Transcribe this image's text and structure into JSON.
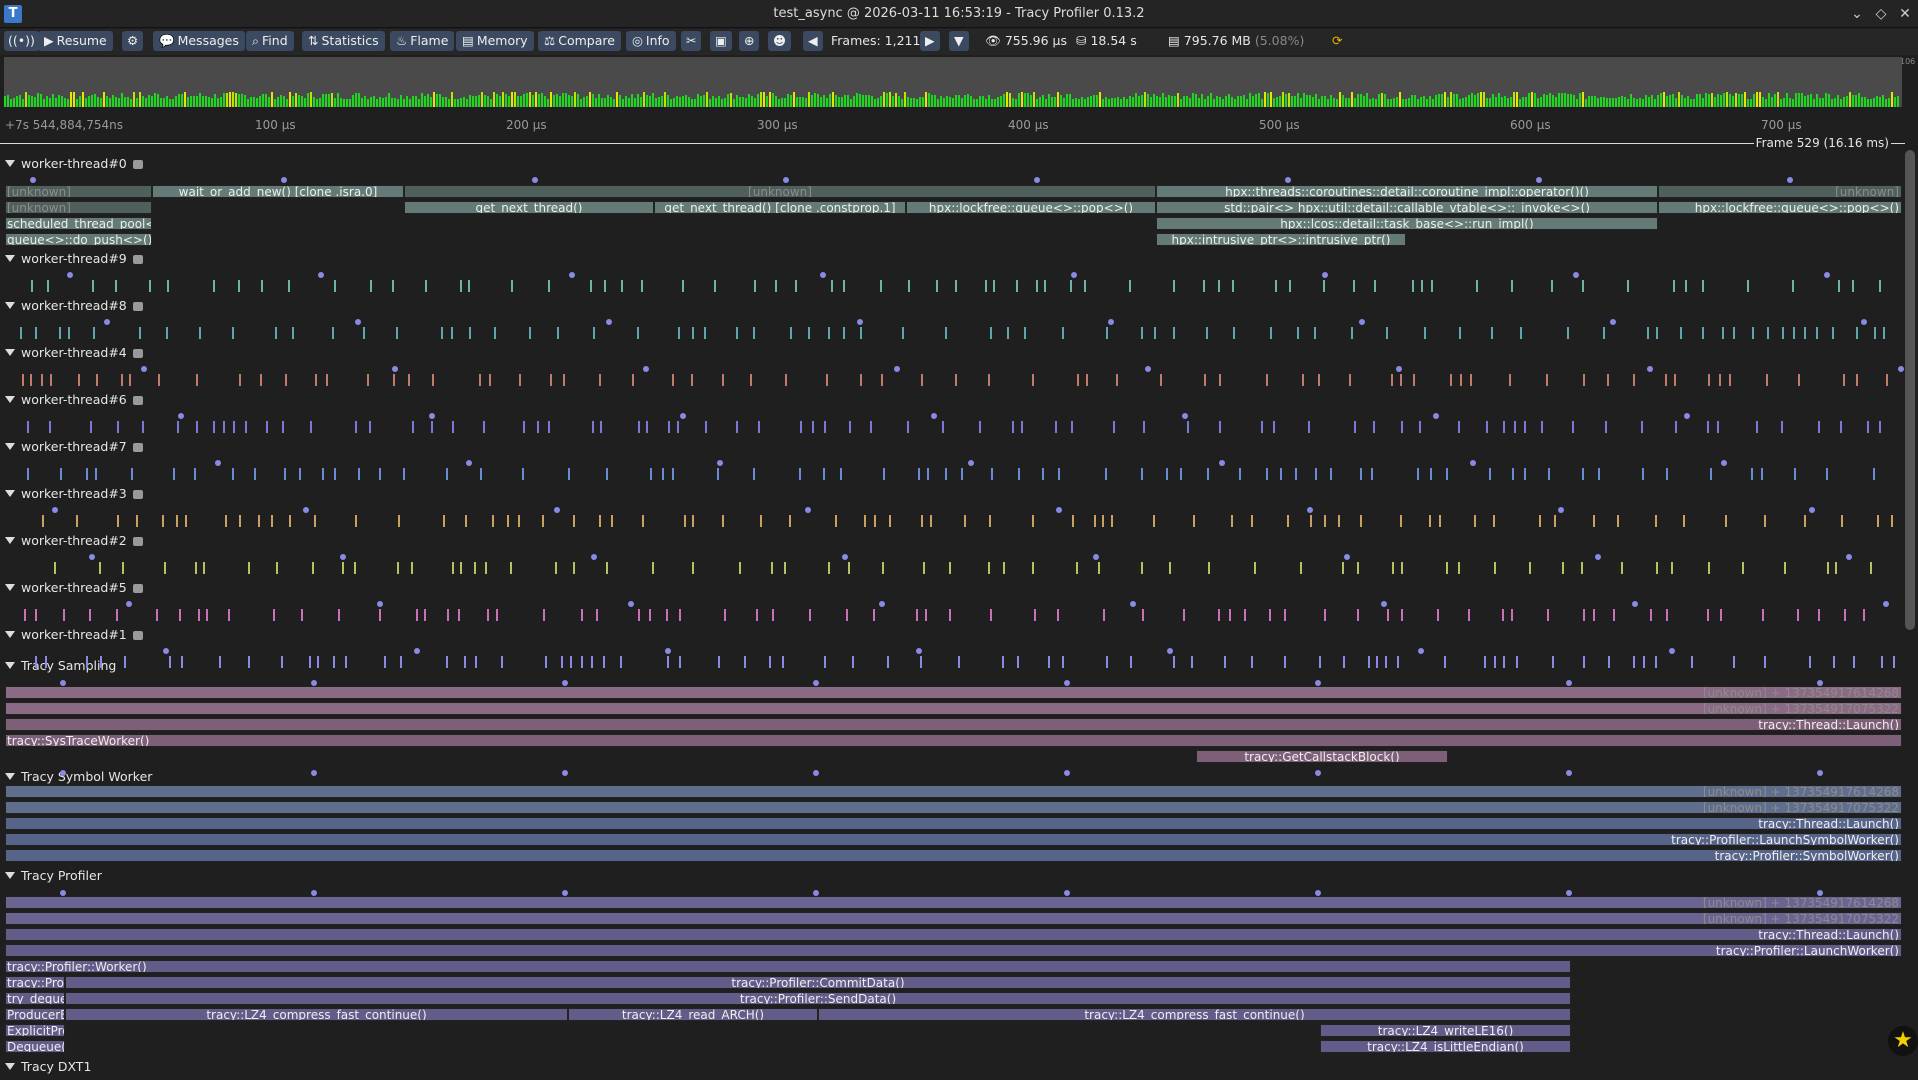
{
  "window": {
    "title": "test_async @ 2026-03-11 16:53:19 - Tracy Profiler 0.13.2",
    "logo": "T"
  },
  "toolbar": {
    "buttons": [
      {
        "name": "resume-button",
        "label": "Resume",
        "icon": "play-icon"
      },
      {
        "name": "settings-button",
        "label": "",
        "icon": "gear-icon"
      },
      {
        "name": "messages-button",
        "label": "Messages",
        "icon": "speech-bubble-icon"
      },
      {
        "name": "find-button",
        "label": "Find",
        "icon": "magnifier-icon"
      },
      {
        "name": "statistics-button",
        "label": "Statistics",
        "icon": "sort-icon"
      },
      {
        "name": "flame-button",
        "label": "Flame",
        "icon": "flame-icon"
      },
      {
        "name": "memory-button",
        "label": "Memory",
        "icon": "memory-icon"
      },
      {
        "name": "compare-button",
        "label": "Compare",
        "icon": "scale-icon"
      },
      {
        "name": "info-button",
        "label": "Info",
        "icon": "fingerprint-icon"
      }
    ],
    "frames_label": "Frames: 1,211",
    "view_time": "755.96 µs",
    "total_time": "18.54 s",
    "memory_used": "795.76 MB",
    "memory_percent": "(5.08%)",
    "top_tick": "106"
  },
  "ruler": {
    "labels": [
      "+7s 544,884,754ns",
      "100 µs",
      "200 µs",
      "300 µs",
      "400 µs",
      "500 µs",
      "600 µs",
      "700 µs"
    ],
    "frame_label": "Frame 529 (16.16 ms)"
  },
  "threads": [
    {
      "label": "worker-thread#0"
    },
    {
      "label": "worker-thread#9"
    },
    {
      "label": "worker-thread#8"
    },
    {
      "label": "worker-thread#4"
    },
    {
      "label": "worker-thread#6"
    },
    {
      "label": "worker-thread#7"
    },
    {
      "label": "worker-thread#3"
    },
    {
      "label": "worker-thread#2"
    },
    {
      "label": "worker-thread#5"
    },
    {
      "label": "worker-thread#1"
    }
  ],
  "sections": {
    "sampling": "Tracy Sampling",
    "symbol": "Tracy Symbol Worker",
    "profiler": "Tracy Profiler",
    "dxt1": "Tracy DXT1"
  },
  "zones_w0": [
    "[unknown]",
    "wait_or_add_new() [clone .isra.0]",
    "[unknown]",
    "hpx::threads::coroutines::detail::coroutine_impl::operator()()",
    "[unknown]",
    "[unknown]",
    "get_next_thread()",
    "get_next_thread() [clone .constprop.1]",
    "hpx::lockfree::queue<>::pop<>()",
    "std::pair<> hpx::util::detail::callable_vtable<>::_invoke<>()",
    "hpx::lockfree::queue<>::pop<>()",
    "scheduled_thread_pool<>::",
    "hpx::lcos::detail::task_base<>::run_impl()",
    "queue<>::do_push<>() [clo",
    "hpx::intrusive_ptr<>::intrusive_ptr()"
  ],
  "zones_sampling": [
    "[unknown] + 137354917614268",
    "[unknown] + 137354917075322",
    "tracy::Thread::Launch()",
    "tracy::SysTraceWorker()",
    "tracy::GetCallstackBlock()"
  ],
  "zones_symbol": [
    "[unknown] + 137354917614268",
    "[unknown] + 137354917075322",
    "tracy::Thread::Launch()",
    "tracy::Profiler::LaunchSymbolWorker()",
    "tracy::Profiler::SymbolWorker()"
  ],
  "zones_profiler": [
    "[unknown] + 137354917614268",
    "[unknown] + 137354917075322",
    "tracy::Thread::Launch()",
    "tracy::Profiler::LaunchWorker()",
    "tracy::Profiler::Worker()",
    "tracy::Profi",
    "tracy::Profiler::CommitData()",
    "try_dequeu",
    "tracy::Profiler::SendData()",
    "ProducerB",
    "tracy::LZ4_compress_fast_continue()",
    "tracy::LZ4_read_ARCH()",
    "tracy::LZ4_compress_fast_continue()",
    "ExplicitPro",
    "tracy::LZ4_writeLE16()",
    "Dequeue():",
    "tracy::LZ4_isLittleEndian()"
  ],
  "colors": {
    "accent": "#3b4a60",
    "w0_zone": "#637a76",
    "w0_dim": "#4e5f5c",
    "sampling": "#8a6a84",
    "symbol": "#5f6e8c",
    "profiler": "#6a6490",
    "dot": "#8a8ae6"
  }
}
